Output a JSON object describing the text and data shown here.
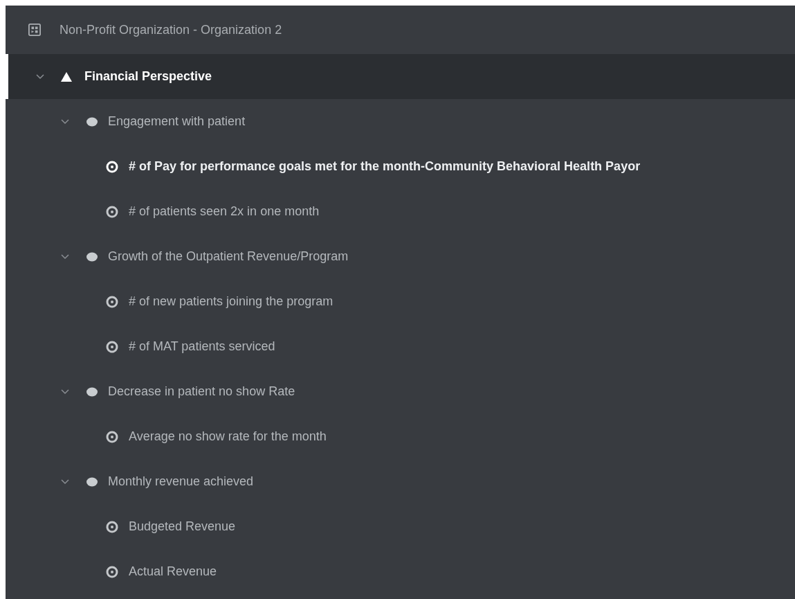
{
  "title": "Non-Profit Organization - Organization 2",
  "perspectives": [
    {
      "name": "Financial Perspective",
      "selected": true,
      "expanded": true,
      "objectives": [
        {
          "name": "Engagement with patient",
          "expanded": true,
          "kpis": [
            {
              "name": "# of Pay for performance goals met for the month-Community Behavioral Health Payor",
              "selected": true
            },
            {
              "name": "# of patients seen 2x in one month",
              "selected": false
            }
          ]
        },
        {
          "name": "Growth of the Outpatient Revenue/Program",
          "expanded": true,
          "kpis": [
            {
              "name": "# of new patients joining the program",
              "selected": false
            },
            {
              "name": "# of MAT patients serviced",
              "selected": false
            }
          ]
        },
        {
          "name": "Decrease in patient no show Rate",
          "expanded": true,
          "kpis": [
            {
              "name": "Average no show rate for the month",
              "selected": false
            }
          ]
        },
        {
          "name": "Monthly revenue achieved",
          "expanded": true,
          "kpis": [
            {
              "name": "Budgeted Revenue",
              "selected": false
            },
            {
              "name": "Actual Revenue",
              "selected": false
            }
          ]
        }
      ]
    }
  ]
}
